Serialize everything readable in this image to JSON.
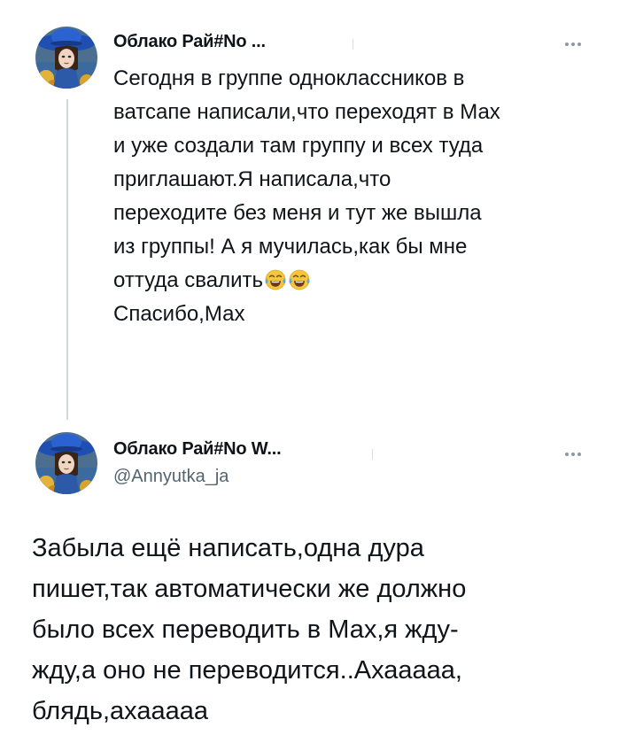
{
  "colors": {
    "text": "#0f1419",
    "secondary": "#536471",
    "thread_line": "#cfd9de",
    "background": "#ffffff"
  },
  "tweet1": {
    "author_name": "Облако Рай#No ...",
    "more_icon": "more-horizontal-icon",
    "text_lines": [
      "Сегодня в  группе одноклассников в",
      "ватсапе написали,что переходят в Мах",
      "и уже создали там группу и всех туда",
      "приглашают.Я написала,что",
      "переходите без меня и тут же вышла",
      "из группы!  А я мучилась,как бы мне",
      "оттуда свалить",
      "Спасибо,Мах"
    ],
    "emoji": "face-with-tears-of-joy-icon"
  },
  "tweet2": {
    "author_name": "Облако Рай#No W...",
    "handle": "@Annyutka_ja",
    "more_icon": "more-horizontal-icon",
    "text_lines": [
      "Забыла ещё написать,одна дура",
      "пишет,так автоматически же должно",
      "было всех переводить в Мах,я жду-",
      "жду,а оно не переводится..Ахааааа,",
      "блядь,ахааааа"
    ]
  }
}
